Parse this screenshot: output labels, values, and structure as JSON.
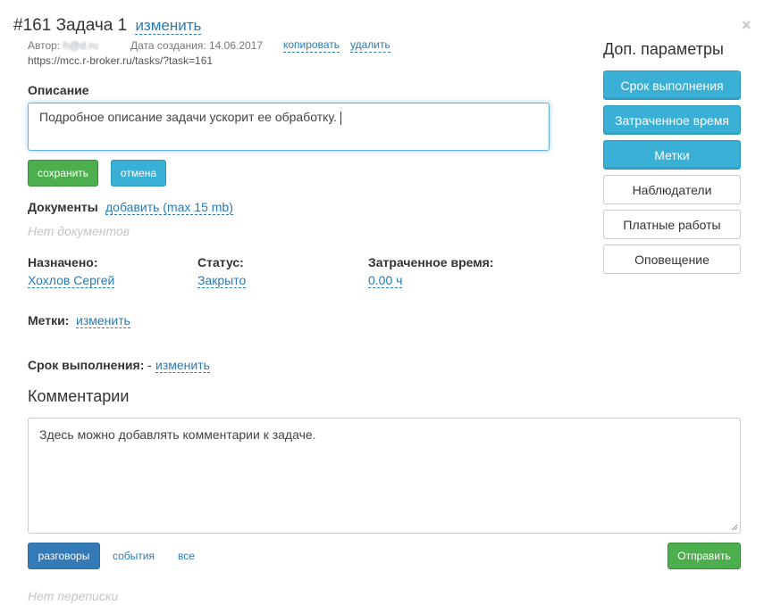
{
  "header": {
    "number": "#161",
    "title": "Задача 1",
    "edit_link": "изменить",
    "author_label": "Автор:",
    "author_email": "h@d.ru",
    "created_label": "Дата создания:",
    "created_date": "14.06.2017",
    "copy_link": "копировать",
    "delete_link": "удалить",
    "url": "https://mcc.r-broker.ru/tasks/?task=161",
    "close_symbol": "×"
  },
  "description": {
    "label": "Описание",
    "value": "Подробное описание задачи ускорит ее обработку.",
    "save_button": "сохранить",
    "cancel_button": "отмена"
  },
  "documents": {
    "label": "Документы",
    "add_link": "добавить (max 15 mb)",
    "empty_text": "Нет документов"
  },
  "fields": {
    "assigned_label": "Назначено:",
    "assigned_value": "Хохлов Сергей",
    "status_label": "Статус:",
    "status_value": "Закрыто",
    "time_label": "Затраченное время:",
    "time_value": "0.00 ч",
    "tags_label": "Метки:",
    "tags_edit": "изменить",
    "deadline_label": "Срок выполнения:",
    "deadline_dash": "-",
    "deadline_edit": "изменить"
  },
  "comments": {
    "title": "Комментарии",
    "placeholder": "Здесь можно добавлять комментарии к задаче.",
    "tab_conversations": "разговоры",
    "tab_events": "события",
    "tab_all": "все",
    "send_button": "Отправить",
    "empty_text": "Нет переписки"
  },
  "sidebar": {
    "title": "Доп. параметры",
    "buttons": [
      {
        "label": "Срок выполнения",
        "active": true
      },
      {
        "label": "Затраченное время",
        "active": true
      },
      {
        "label": "Метки",
        "active": true
      },
      {
        "label": "Наблюдатели",
        "active": false
      },
      {
        "label": "Платные работы",
        "active": false
      },
      {
        "label": "Оповещение",
        "active": false
      }
    ]
  },
  "colors": {
    "link": "#2a7ab5",
    "accent_teal": "#3ab0d6",
    "success_green": "#4cae4c",
    "primary_blue": "#337ab7"
  }
}
